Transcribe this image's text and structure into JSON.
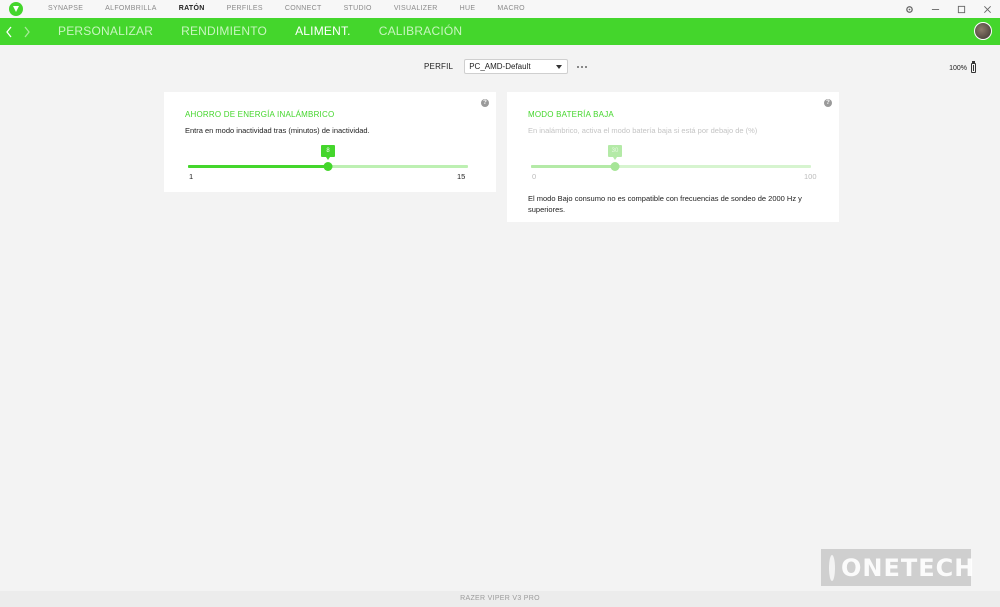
{
  "topnav": {
    "items": [
      "SYNAPSE",
      "ALFOMBRILLA",
      "RATÓN",
      "PERFILES",
      "CONNECT",
      "STUDIO",
      "VISUALIZER",
      "HUE",
      "MACRO"
    ],
    "active": "RATÓN"
  },
  "subnav": {
    "tabs": [
      "PERSONALIZAR",
      "RENDIMIENTO",
      "ALIMENT.",
      "CALIBRACIÓN"
    ],
    "active": "ALIMENT."
  },
  "profile": {
    "label": "PERFIL",
    "selected": "PC_AMD-Default"
  },
  "battery": {
    "level_text": "100%"
  },
  "card_wireless": {
    "title": "AHORRO DE ENERGÍA INALÁMBRICO",
    "description": "Entra en modo inactividad tras (minutos) de inactividad.",
    "slider": {
      "value": "8",
      "min": "1",
      "max": "15",
      "fraction": 0.5
    }
  },
  "card_lowbattery": {
    "title": "MODO BATERÍA BAJA",
    "description": "En inalámbrico, activa el modo batería baja si está por debajo de (%)",
    "slider": {
      "value": "30",
      "min": "0",
      "max": "100",
      "fraction": 0.3
    },
    "note": "El modo Bajo consumo no es compatible con frecuencias de sondeo de 2000 Hz y superiores."
  },
  "watermark": {
    "text": "ONETECH"
  },
  "footer": {
    "device_name": "RAZER VIPER V3 PRO"
  },
  "colors": {
    "accent": "#44d62c",
    "background": "#f3f3f3"
  }
}
